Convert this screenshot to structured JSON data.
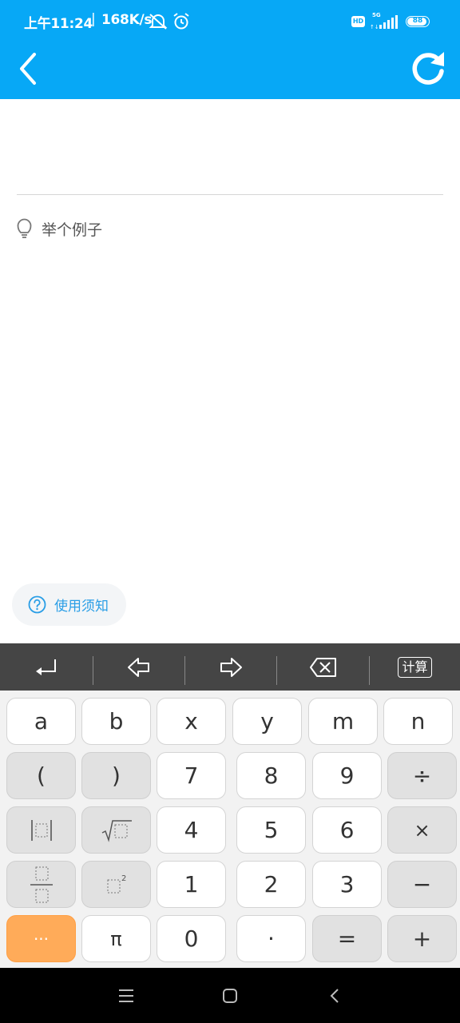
{
  "status_bar": {
    "time": "上午11:24",
    "separator": "|",
    "net_speed": "168K/s",
    "hd_badge": "HD",
    "network_type": "5G",
    "battery_level": "88"
  },
  "header": {
    "background_color": "#07a8f6",
    "back_icon": "chevron-left-icon",
    "refresh_icon": "refresh-icon"
  },
  "input": {
    "value": ""
  },
  "example": {
    "label": "举个例子",
    "icon": "lightbulb-icon"
  },
  "notice": {
    "label": "使用须知",
    "icon": "question-circle-icon"
  },
  "toolbar": {
    "enter_icon": "enter-icon",
    "cursor_left_icon": "arrow-left-icon",
    "cursor_right_icon": "arrow-right-icon",
    "backspace_icon": "backspace-icon",
    "calc_label": "计算"
  },
  "keypad": {
    "row1": [
      "a",
      "b",
      "x",
      "y",
      "m",
      "n"
    ],
    "row2": [
      "(",
      ")",
      "7",
      "8",
      "9",
      "÷"
    ],
    "row3": [
      "4",
      "5",
      "6",
      "×"
    ],
    "row4": [
      "1",
      "2",
      "3",
      "−"
    ],
    "row5": [
      "···",
      "π",
      "0",
      "·",
      "=",
      "+"
    ],
    "template_keys": [
      "abs-template-icon",
      "sqrt-template-icon",
      "fraction-template-icon",
      "power-template-icon"
    ],
    "accent_color": "#ffab59"
  },
  "nav_bar": {
    "menu_icon": "menu-icon",
    "home_icon": "home-icon",
    "back_icon": "back-triangle-icon"
  }
}
